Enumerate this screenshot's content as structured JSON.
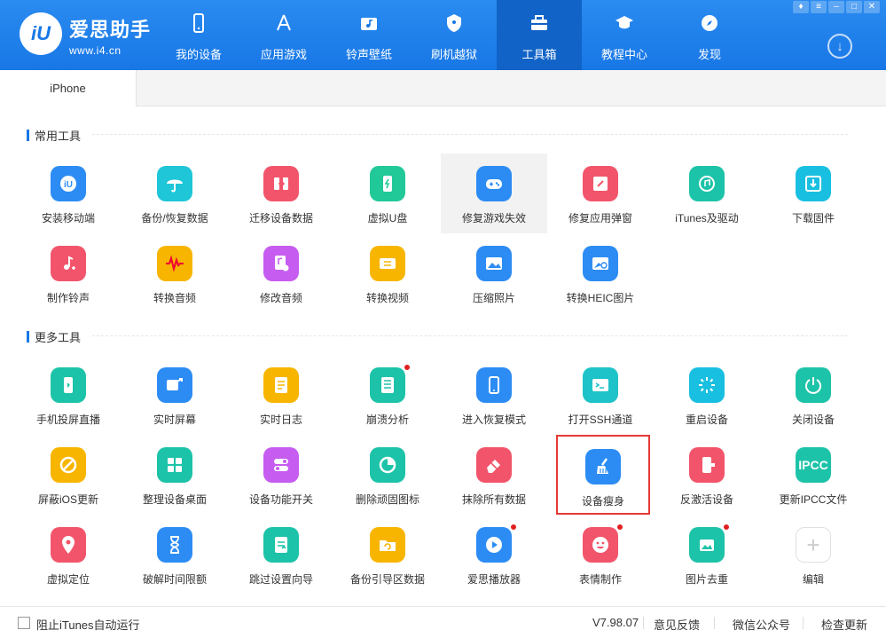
{
  "brand": {
    "name": "爱思助手",
    "url": "www.i4.cn",
    "logo_text": "iU"
  },
  "nav": [
    {
      "label": "我的设备",
      "icon": "phone-icon"
    },
    {
      "label": "应用游戏",
      "icon": "app-store-icon"
    },
    {
      "label": "铃声壁纸",
      "icon": "music-folder-icon"
    },
    {
      "label": "刷机越狱",
      "icon": "shield-key-icon"
    },
    {
      "label": "工具箱",
      "icon": "toolbox-icon",
      "active": true
    },
    {
      "label": "教程中心",
      "icon": "graduation-cap-icon"
    },
    {
      "label": "发现",
      "icon": "compass-icon"
    }
  ],
  "window_controls": [
    "shirt-icon",
    "menu-icon",
    "minimize-icon",
    "maximize-icon",
    "close-icon"
  ],
  "tab": {
    "label": "iPhone"
  },
  "sections": {
    "common": {
      "title": "常用工具"
    },
    "more": {
      "title": "更多工具"
    }
  },
  "common_tools": [
    {
      "label": "安装移动端",
      "icon": "iu-logo-icon",
      "color": "#2c8cf4"
    },
    {
      "label": "备份/恢复数据",
      "icon": "umbrella-icon",
      "color": "#1ec6d8"
    },
    {
      "label": "迁移设备数据",
      "icon": "transfer-icon",
      "color": "#f2556b"
    },
    {
      "label": "虚拟U盘",
      "icon": "usb-drive-icon",
      "color": "#20c997"
    },
    {
      "label": "修复游戏失效",
      "icon": "gamepad-icon",
      "color": "#2c8cf4"
    },
    {
      "label": "修复应用弹窗",
      "icon": "app-repair-icon",
      "color": "#f2556b"
    },
    {
      "label": "iTunes及驱动",
      "icon": "itunes-icon",
      "color": "#1dc3a8"
    },
    {
      "label": "下载固件",
      "icon": "download-box-icon",
      "color": "#19bfe0"
    },
    {
      "label": "制作铃声",
      "icon": "ringtone-icon",
      "color": "#f2556b"
    },
    {
      "label": "转换音频",
      "icon": "waveform-icon",
      "color": "#f7b500"
    },
    {
      "label": "修改音频",
      "icon": "audio-edit-icon",
      "color": "#c65cf0"
    },
    {
      "label": "转换视频",
      "icon": "video-convert-icon",
      "color": "#f7b500"
    },
    {
      "label": "压缩照片",
      "icon": "photo-icon",
      "color": "#2c8cf4"
    },
    {
      "label": "转换HEIC图片",
      "icon": "heic-photo-icon",
      "color": "#2c8cf4"
    }
  ],
  "more_tools": [
    {
      "label": "手机投屏直播",
      "icon": "screen-cast-icon",
      "color": "#1dc3a8"
    },
    {
      "label": "实时屏幕",
      "icon": "live-screen-icon",
      "color": "#2c8cf4"
    },
    {
      "label": "实时日志",
      "icon": "log-icon",
      "color": "#f7b500"
    },
    {
      "label": "崩溃分析",
      "icon": "crash-analysis-icon",
      "color": "#1dc3a8",
      "badge": true
    },
    {
      "label": "进入恢复模式",
      "icon": "recovery-mode-icon",
      "color": "#2c8cf4"
    },
    {
      "label": "打开SSH通道",
      "icon": "terminal-icon",
      "color": "#1dc3c8"
    },
    {
      "label": "重启设备",
      "icon": "restart-icon",
      "color": "#19bfe0"
    },
    {
      "label": "关闭设备",
      "icon": "power-icon",
      "color": "#1dc3a8"
    },
    {
      "label": "屏蔽iOS更新",
      "icon": "block-update-icon",
      "color": "#f7b500"
    },
    {
      "label": "整理设备桌面",
      "icon": "grid-icon",
      "color": "#1dc3a8"
    },
    {
      "label": "设备功能开关",
      "icon": "toggle-icon",
      "color": "#c65cf0"
    },
    {
      "label": "删除顽固图标",
      "icon": "pie-icon",
      "color": "#1dc3a8"
    },
    {
      "label": "抹除所有数据",
      "icon": "eraser-icon",
      "color": "#f2556b"
    },
    {
      "label": "设备瘦身",
      "icon": "broom-icon",
      "color": "#2c8cf4",
      "selected": true
    },
    {
      "label": "反激活设备",
      "icon": "deactivate-icon",
      "color": "#f2556b"
    },
    {
      "label": "更新IPCC文件",
      "icon": "ipcc-icon",
      "color": "#1dc3a8",
      "text_icon": "IPCC"
    },
    {
      "label": "虚拟定位",
      "icon": "location-pin-icon",
      "color": "#f2556b"
    },
    {
      "label": "破解时间限额",
      "icon": "hourglass-icon",
      "color": "#2c8cf4"
    },
    {
      "label": "跳过设置向导",
      "icon": "skip-wizard-icon",
      "color": "#1dc3a8"
    },
    {
      "label": "备份引导区数据",
      "icon": "backup-folder-icon",
      "color": "#f7b500"
    },
    {
      "label": "爱思播放器",
      "icon": "play-icon",
      "color": "#2c8cf4",
      "badge": true
    },
    {
      "label": "表情制作",
      "icon": "emoji-icon",
      "color": "#f2556b",
      "badge": true
    },
    {
      "label": "图片去重",
      "icon": "image-dedupe-icon",
      "color": "#1dc3a8",
      "badge": true
    },
    {
      "label": "编辑",
      "icon": "plus-icon",
      "color": "#ffffff",
      "is_edit": true
    }
  ],
  "footer": {
    "checkbox_label": "阻止iTunes自动运行",
    "version": "V7.98.07",
    "feedback": "意见反馈",
    "wechat": "微信公众号",
    "check_update": "检查更新"
  }
}
